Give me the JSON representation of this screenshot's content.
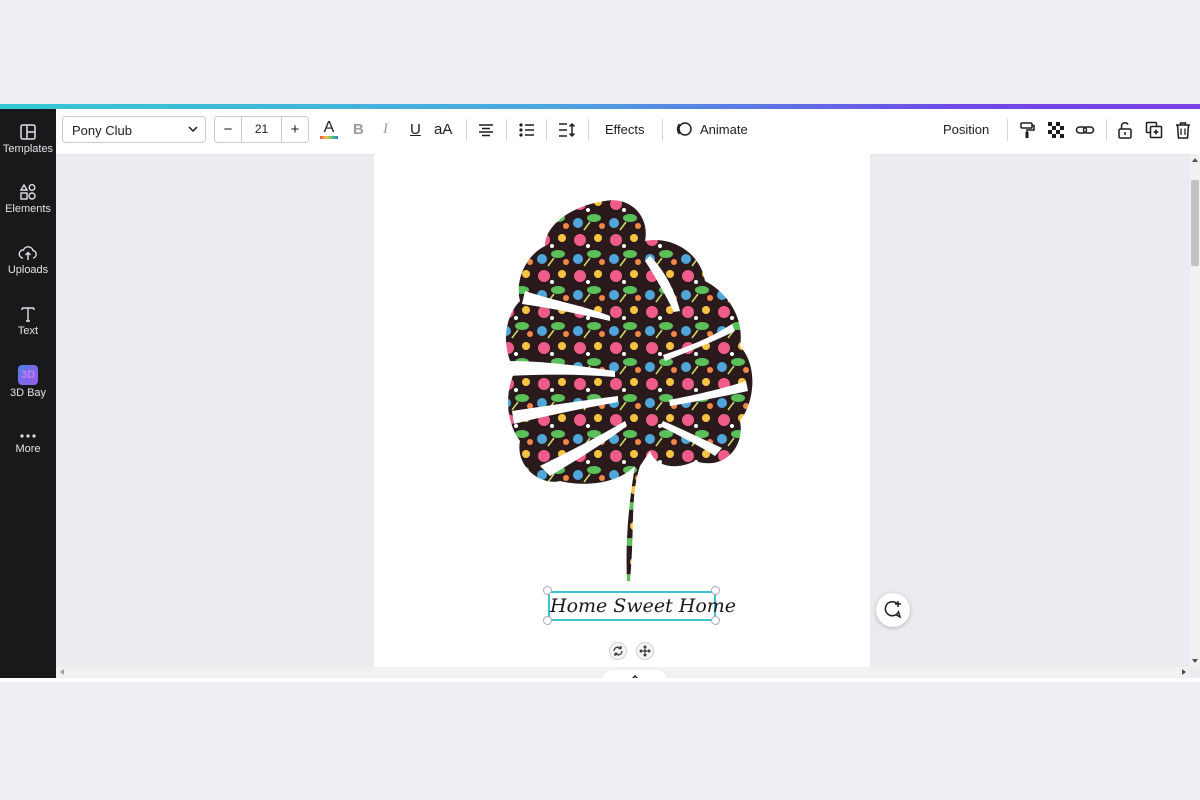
{
  "sidebar": {
    "items": [
      {
        "label": "Templates",
        "icon": "templates-icon"
      },
      {
        "label": "Elements",
        "icon": "elements-icon"
      },
      {
        "label": "Uploads",
        "icon": "uploads-icon"
      },
      {
        "label": "Text",
        "icon": "text-icon"
      },
      {
        "label": "3D Bay",
        "icon": "3d-bay-icon",
        "badge": "3D"
      },
      {
        "label": "More",
        "icon": "more-icon"
      }
    ]
  },
  "toolbar": {
    "font_name": "Pony Club",
    "font_size": "21",
    "decrease": "−",
    "increase": "+",
    "text_color_glyph": "A",
    "bold_glyph": "B",
    "italic_glyph": "I",
    "underline_glyph": "U",
    "case_glyph": "aA",
    "effects_label": "Effects",
    "animate_label": "Animate",
    "position_label": "Position"
  },
  "canvas": {
    "text_element": "Home Sweet Home",
    "leaf_image": "monstera-leaf-floral-pattern"
  },
  "colors": {
    "accent_gradient_start": "#35c7d2",
    "accent_gradient_end": "#7b3fe4",
    "selection": "#3cc3d0",
    "sidebar_bg": "#18191b"
  }
}
